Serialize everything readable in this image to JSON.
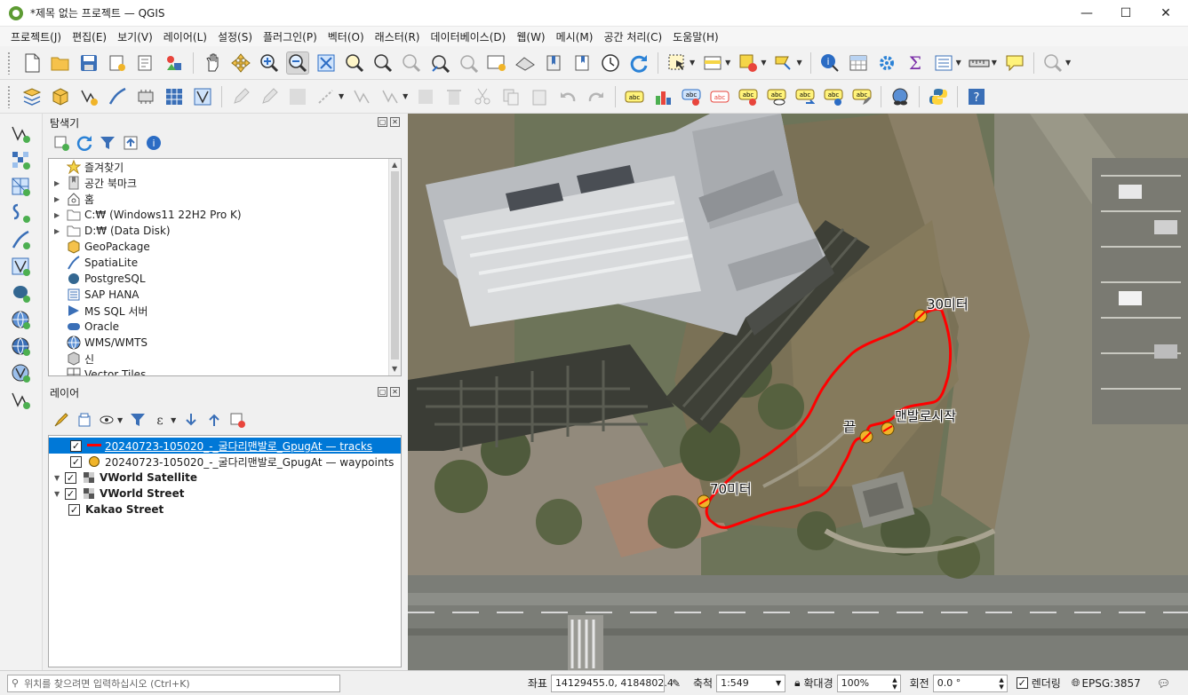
{
  "window": {
    "title": "*제목 없는 프로젝트 — QGIS",
    "minimize": "—",
    "maximize": "☐",
    "close": "✕"
  },
  "menu": [
    {
      "label": "프로젝트(J)"
    },
    {
      "label": "편집(E)"
    },
    {
      "label": "보기(V)"
    },
    {
      "label": "레이어(L)"
    },
    {
      "label": "설정(S)"
    },
    {
      "label": "플러그인(P)"
    },
    {
      "label": "벡터(O)"
    },
    {
      "label": "래스터(R)"
    },
    {
      "label": "데이터베이스(D)"
    },
    {
      "label": "웹(W)"
    },
    {
      "label": "메시(M)"
    },
    {
      "label": "공간 처리(C)"
    },
    {
      "label": "도움말(H)"
    }
  ],
  "browser": {
    "title": "탐색기",
    "items": [
      {
        "label": "즐겨찾기",
        "icon": "star-icon",
        "expandable": false
      },
      {
        "label": "공간 북마크",
        "icon": "bookmark-icon",
        "expandable": true
      },
      {
        "label": "홈",
        "icon": "home-icon",
        "expandable": true
      },
      {
        "label": "C:₩ (Windows11 22H2 Pro K)",
        "icon": "folder-icon",
        "expandable": true
      },
      {
        "label": "D:₩ (Data Disk)",
        "icon": "folder-icon",
        "expandable": true
      },
      {
        "label": "GeoPackage",
        "icon": "geopackage-icon",
        "expandable": false
      },
      {
        "label": "SpatiaLite",
        "icon": "spatialite-icon",
        "expandable": false
      },
      {
        "label": "PostgreSQL",
        "icon": "postgresql-icon",
        "expandable": false
      },
      {
        "label": "SAP HANA",
        "icon": "sap-hana-icon",
        "expandable": false
      },
      {
        "label": "MS SQL 서버",
        "icon": "mssql-icon",
        "expandable": false
      },
      {
        "label": "Oracle",
        "icon": "oracle-icon",
        "expandable": false
      },
      {
        "label": "WMS/WMTS",
        "icon": "globe-icon",
        "expandable": false
      },
      {
        "label": "신",
        "icon": "xyz-icon",
        "expandable": false
      },
      {
        "label": "Vector Tiles",
        "icon": "vector-tiles-icon",
        "expandable": false
      }
    ]
  },
  "layers": {
    "title": "레이어",
    "items": [
      {
        "label": "20240723-105020_-_굴다리맨발로_GpugAt — tracks",
        "symbol": "line",
        "checked": true,
        "selected": true,
        "bold": false,
        "indent": 1
      },
      {
        "label": "20240723-105020_-_굴다리맨발로_GpugAt — waypoints",
        "symbol": "point",
        "checked": true,
        "selected": false,
        "bold": false,
        "indent": 1
      },
      {
        "label": "VWorld Satellite",
        "symbol": "raster",
        "checked": true,
        "selected": false,
        "bold": true,
        "indent": 0
      },
      {
        "label": "VWorld Street",
        "symbol": "raster",
        "checked": true,
        "selected": false,
        "bold": true,
        "indent": 0
      },
      {
        "label": "Kakao Street",
        "symbol": "none",
        "checked": true,
        "selected": false,
        "bold": true,
        "indent": 0
      }
    ]
  },
  "map": {
    "labels": {
      "m30": "30미터",
      "end": "끝",
      "start": "맨발로시작",
      "m70": "70미터"
    },
    "track_color": "#ff0000",
    "waypoint_color": "#f0b429"
  },
  "status": {
    "search_placeholder": "위치를 찾으려면 입력하십시오 (Ctrl+K)",
    "coord_label": "좌표",
    "coord_value": "14129455.0, 4184802.4",
    "scale_label": "축척",
    "scale_value": "1:549",
    "magnifier_label": "확대경",
    "magnifier_value": "100%",
    "rotation_label": "회전",
    "rotation_value": "0.0 °",
    "render_label": "렌더링",
    "crs": "EPSG:3857"
  }
}
